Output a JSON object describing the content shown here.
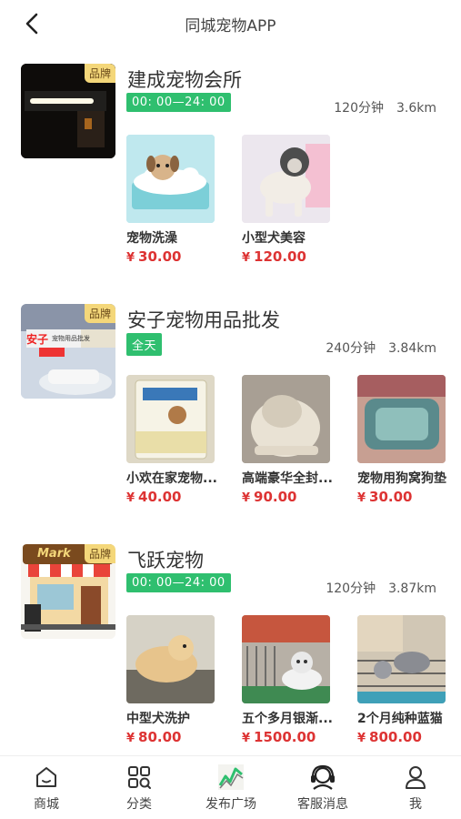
{
  "header": {
    "title": "同城宠物APP"
  },
  "stores": [
    {
      "name": "建成宠物会所",
      "badge": "品牌",
      "hours": "00: 00—24: 00",
      "duration": "120分钟",
      "distance": "3.6km",
      "products": [
        {
          "name": "宠物洗澡",
          "currency": "¥",
          "price": "30.00"
        },
        {
          "name": "小型犬美容",
          "currency": "¥",
          "price": "120.00"
        }
      ]
    },
    {
      "name": "安子宠物用品批发",
      "badge": "品牌",
      "hours": "全天",
      "duration": "240分钟",
      "distance": "3.84km",
      "products": [
        {
          "name": "小欢在家宠物...",
          "currency": "¥",
          "price": "40.00"
        },
        {
          "name": "高端豪华全封...",
          "currency": "¥",
          "price": "90.00"
        },
        {
          "name": "宠物用狗窝狗垫",
          "currency": "¥",
          "price": "30.00"
        }
      ]
    },
    {
      "name": "飞跃宠物",
      "badge": "品牌",
      "hours": "00: 00—24: 00",
      "duration": "120分钟",
      "distance": "3.87km",
      "products": [
        {
          "name": "中型犬洗护",
          "currency": "¥",
          "price": "80.00"
        },
        {
          "name": "五个多月银渐...",
          "currency": "¥",
          "price": "1500.00"
        },
        {
          "name": "2个月纯种蓝猫",
          "currency": "¥",
          "price": "800.00"
        }
      ]
    }
  ],
  "thumb_text": {
    "market_sign": "Mark",
    "shop_sign_a": "安子",
    "shop_sign_b": "宠物用品批发"
  },
  "nav": [
    {
      "label": "商城",
      "icon": "home-icon"
    },
    {
      "label": "分类",
      "icon": "category-grid-icon"
    },
    {
      "label": "发布广场",
      "icon": "publish-chart-icon"
    },
    {
      "label": "客服消息",
      "icon": "headset-icon"
    },
    {
      "label": "我",
      "icon": "user-icon"
    }
  ],
  "colors": {
    "accent_green": "#2fbf6f",
    "price_red": "#dd3333",
    "brand_gold": "#f4d77a"
  }
}
